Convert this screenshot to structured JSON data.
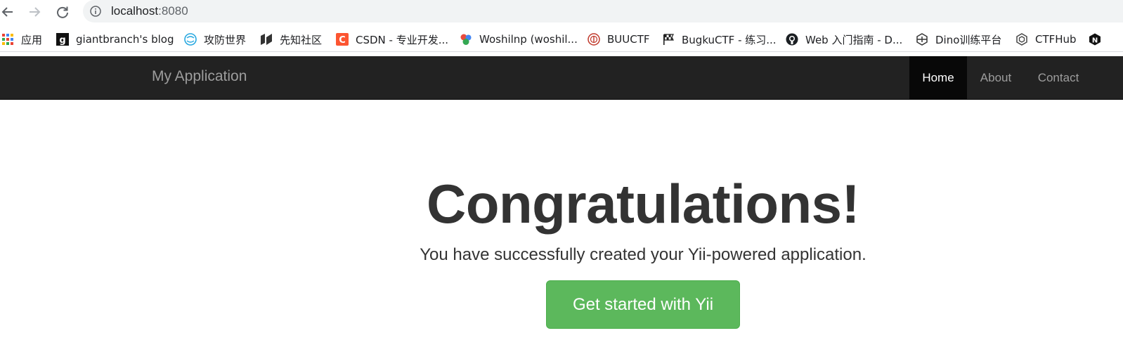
{
  "browser": {
    "url_host": "localhost",
    "url_port": ":8080"
  },
  "bookmarks": [
    {
      "label": "应用",
      "icon": "apps-grid-icon"
    },
    {
      "label": "giantbranch's blog",
      "icon": "g-logo-icon"
    },
    {
      "label": "攻防世界",
      "icon": "globe-icon"
    },
    {
      "label": "先知社区",
      "icon": "xianzhi-logo-icon"
    },
    {
      "label": "CSDN - 专业开发...",
      "icon": "csdn-logo-icon"
    },
    {
      "label": "Woshilnp (woshil...",
      "icon": "colored-dots-icon"
    },
    {
      "label": "BUUCTF",
      "icon": "buuctf-logo-icon"
    },
    {
      "label": "BugkuCTF - 练习...",
      "icon": "checkered-flag-icon"
    },
    {
      "label": "Web 入门指南 - D...",
      "icon": "github-icon"
    },
    {
      "label": "Dino训练平台",
      "icon": "dino-logo-icon"
    },
    {
      "label": "CTFHub",
      "icon": "ctfhub-logo-icon"
    },
    {
      "label": "",
      "icon": "n-logo-icon"
    }
  ],
  "navbar": {
    "brand": "My Application",
    "links": [
      {
        "label": "Home",
        "active": true
      },
      {
        "label": "About",
        "active": false
      },
      {
        "label": "Contact",
        "active": false
      }
    ]
  },
  "jumbotron": {
    "title": "Congratulations!",
    "lead": "You have successfully created your Yii-powered application.",
    "button": "Get started with Yii"
  },
  "colors": {
    "navbar_bg": "#222222",
    "navbar_active_bg": "#080808",
    "success_button": "#5cb85c"
  }
}
